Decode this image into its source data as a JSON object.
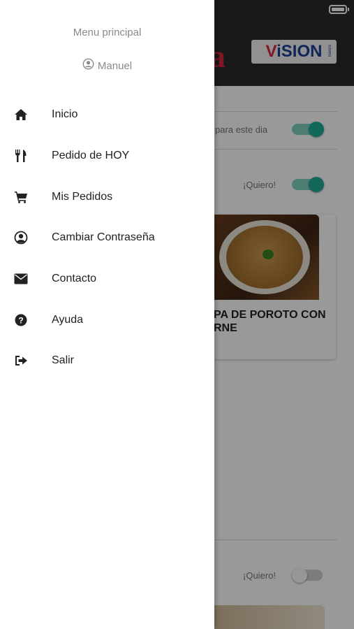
{
  "background": {
    "brand_partial": "a",
    "brand_logo": {
      "text_red": "V",
      "text_blue": "iSION",
      "sub": "Banco"
    },
    "toggle_label_1": "r para este dia",
    "toggle_1": "on",
    "quiero_label_1": "¡Quiero!",
    "toggle_2": "on",
    "food_title": "PA DE POROTO CON\nRNE",
    "quiero_label_2": "¡Quiero!",
    "toggle_3": "off"
  },
  "drawer": {
    "title": "Menu principal",
    "user": {
      "icon": "user-circle-icon",
      "name": "Manuel"
    },
    "items": [
      {
        "label": "Inicio",
        "icon": "home-icon"
      },
      {
        "label": "Pedido de HOY",
        "icon": "utensils-icon"
      },
      {
        "label": "Mis Pedidos",
        "icon": "cart-icon"
      },
      {
        "label": "Cambiar Contraseña",
        "icon": "user-circle-icon"
      },
      {
        "label": "Contacto",
        "icon": "envelope-icon"
      },
      {
        "label": "Ayuda",
        "icon": "question-circle-icon"
      },
      {
        "label": "Salir",
        "icon": "sign-out-icon"
      }
    ]
  },
  "colors": {
    "accent": "#1fae98",
    "header": "#2b2b2b",
    "brand_red": "#d7263d",
    "brand_blue": "#1c3f94"
  }
}
